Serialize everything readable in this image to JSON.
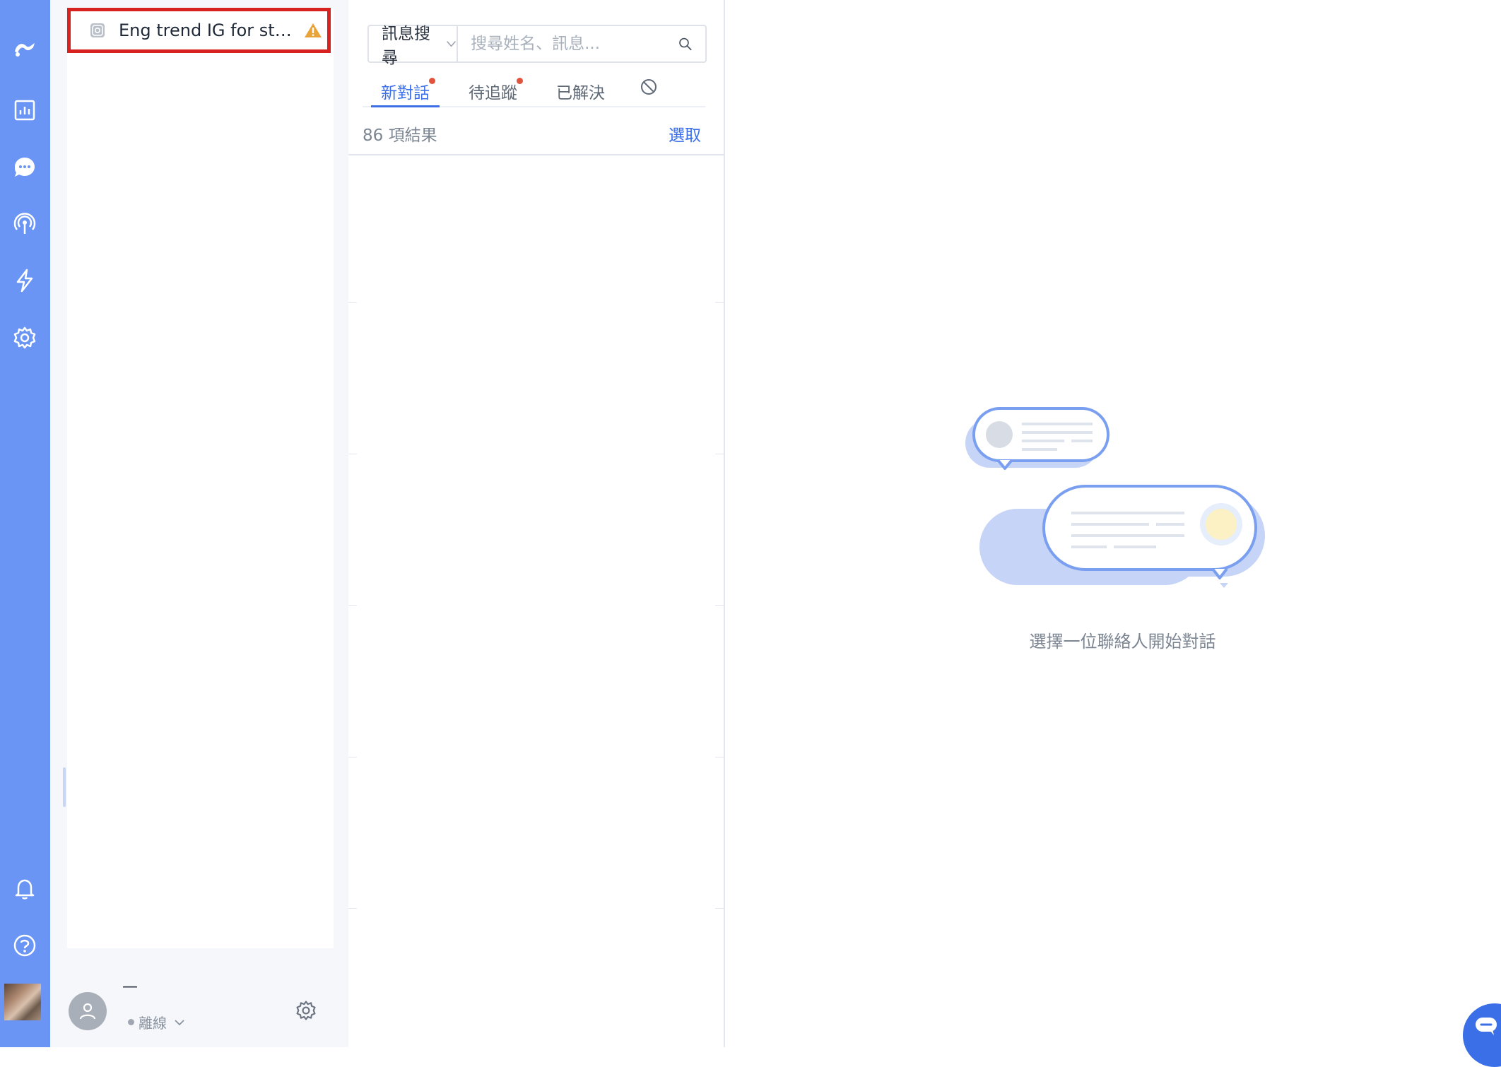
{
  "channel": {
    "name": "Eng trend IG for stag…"
  },
  "user": {
    "name": "—",
    "status": "離線"
  },
  "search": {
    "type_label": "訊息搜尋",
    "placeholder": "搜尋姓名、訊息..."
  },
  "tabs": [
    {
      "label": "新對話",
      "badge": true,
      "active": true
    },
    {
      "label": "待追蹤",
      "badge": true,
      "active": false
    },
    {
      "label": "已解決",
      "badge": false,
      "active": false
    }
  ],
  "list": {
    "result_count": "86 項結果",
    "select_label": "選取"
  },
  "empty_state": {
    "message": "選擇一位聯絡人開始對話"
  },
  "icons": {
    "rail": [
      "logo-icon",
      "analytics-icon",
      "chat-icon",
      "broadcast-icon",
      "automation-icon",
      "settings-icon",
      "bell-icon",
      "help-icon"
    ],
    "channel": [
      "instagram-icon",
      "warning-icon"
    ]
  },
  "colors": {
    "rail": "#6a95f4",
    "accent": "#3a6fe8",
    "badge": "#e0533d",
    "warning": "#e8a33a",
    "highlight_border": "#d7221f"
  }
}
